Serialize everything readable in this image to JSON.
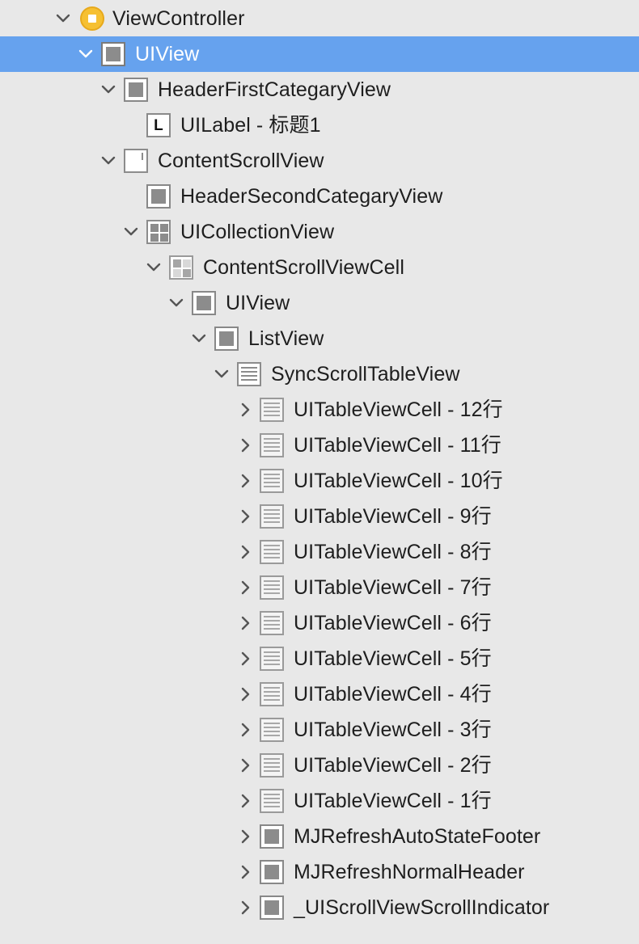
{
  "tree": {
    "rows": [
      {
        "label": "ViewController",
        "icon": "view-controller-icon",
        "disclosure": "expanded"
      },
      {
        "label": "UIView",
        "icon": "view-icon",
        "disclosure": "expanded",
        "selected": true
      },
      {
        "label": "HeaderFirstCategaryView",
        "icon": "view-icon",
        "disclosure": "expanded"
      },
      {
        "label": "UILabel - 标题1",
        "icon": "label-icon",
        "icon_text": "L",
        "disclosure": "none"
      },
      {
        "label": "ContentScrollView",
        "icon": "scroll-view-icon",
        "disclosure": "expanded"
      },
      {
        "label": "HeaderSecondCategaryView",
        "icon": "view-icon",
        "disclosure": "none"
      },
      {
        "label": "UICollectionView",
        "icon": "collection-view-icon",
        "disclosure": "expanded"
      },
      {
        "label": "ContentScrollViewCell",
        "icon": "collection-cell-icon",
        "disclosure": "expanded"
      },
      {
        "label": "UIView",
        "icon": "view-icon",
        "disclosure": "expanded"
      },
      {
        "label": "ListView",
        "icon": "view-icon",
        "disclosure": "expanded"
      },
      {
        "label": "SyncScrollTableView",
        "icon": "table-view-icon",
        "disclosure": "expanded"
      },
      {
        "label": "UITableViewCell - 12行",
        "icon": "table-cell-icon",
        "disclosure": "collapsed"
      },
      {
        "label": "UITableViewCell - 11行",
        "icon": "table-cell-icon",
        "disclosure": "collapsed"
      },
      {
        "label": "UITableViewCell - 10行",
        "icon": "table-cell-icon",
        "disclosure": "collapsed"
      },
      {
        "label": "UITableViewCell - 9行",
        "icon": "table-cell-icon",
        "disclosure": "collapsed"
      },
      {
        "label": "UITableViewCell - 8行",
        "icon": "table-cell-icon",
        "disclosure": "collapsed"
      },
      {
        "label": "UITableViewCell - 7行",
        "icon": "table-cell-icon",
        "disclosure": "collapsed"
      },
      {
        "label": "UITableViewCell - 6行",
        "icon": "table-cell-icon",
        "disclosure": "collapsed"
      },
      {
        "label": "UITableViewCell - 5行",
        "icon": "table-cell-icon",
        "disclosure": "collapsed"
      },
      {
        "label": "UITableViewCell - 4行",
        "icon": "table-cell-icon",
        "disclosure": "collapsed"
      },
      {
        "label": "UITableViewCell - 3行",
        "icon": "table-cell-icon",
        "disclosure": "collapsed"
      },
      {
        "label": "UITableViewCell - 2行",
        "icon": "table-cell-icon",
        "disclosure": "collapsed"
      },
      {
        "label": "UITableViewCell - 1行",
        "icon": "table-cell-icon",
        "disclosure": "collapsed"
      },
      {
        "label": "MJRefreshAutoStateFooter",
        "icon": "view-icon",
        "disclosure": "collapsed"
      },
      {
        "label": "MJRefreshNormalHeader",
        "icon": "view-icon",
        "disclosure": "collapsed"
      },
      {
        "label": "_UIScrollViewScrollIndicator",
        "icon": "view-icon",
        "disclosure": "collapsed"
      }
    ]
  },
  "colors": {
    "background": "#e8e8e8",
    "selection": "#66a2ee",
    "selected_text": "#ffffff",
    "text": "#1e1e1e"
  }
}
